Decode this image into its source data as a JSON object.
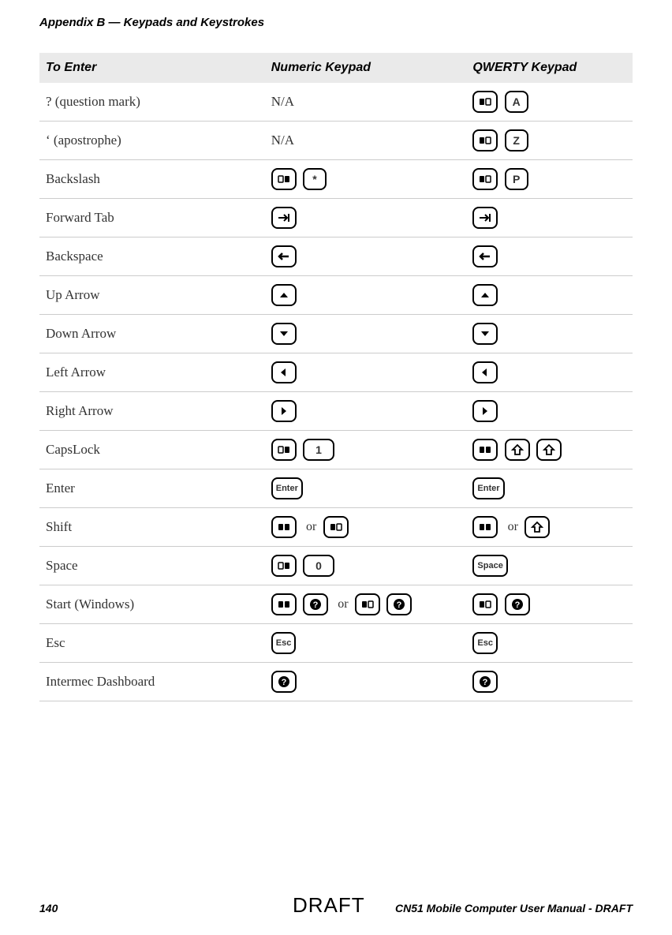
{
  "header": "Appendix B — Keypads and Keystrokes",
  "columns": {
    "c1": "To Enter",
    "c2": "Numeric Keypad",
    "c3": "QWERTY Keypad"
  },
  "rows": {
    "qmark": {
      "label": "? (question mark)",
      "numeric_text": "N/A"
    },
    "apos": {
      "label": "‘ (apostrophe)",
      "numeric_text": "N/A"
    },
    "backslash": {
      "label": "Backslash"
    },
    "fwdtab": {
      "label": "Forward Tab"
    },
    "backspace": {
      "label": "Backspace"
    },
    "uparrow": {
      "label": "Up Arrow"
    },
    "downarrow": {
      "label": "Down Arrow"
    },
    "leftarrow": {
      "label": "Left Arrow"
    },
    "rightarrow": {
      "label": "Right Arrow"
    },
    "capslock": {
      "label": "CapsLock"
    },
    "enter": {
      "label": "Enter",
      "keytext": "Enter"
    },
    "shift": {
      "label": "Shift",
      "or": "or"
    },
    "space": {
      "label": "Space",
      "keytext": "Space"
    },
    "start": {
      "label": "Start (Windows)",
      "or": "or"
    },
    "esc": {
      "label": "Esc",
      "keytext": "Esc"
    },
    "dashboard": {
      "label": "Intermec Dashboard"
    }
  },
  "keys": {
    "a": "A",
    "z": "Z",
    "p": "P",
    "star": "*",
    "one": "1",
    "zero": "0"
  },
  "footer": {
    "page": "140",
    "manual": "CN51 Mobile Computer User Manual - DRAFT",
    "watermark": "DRAFT"
  }
}
